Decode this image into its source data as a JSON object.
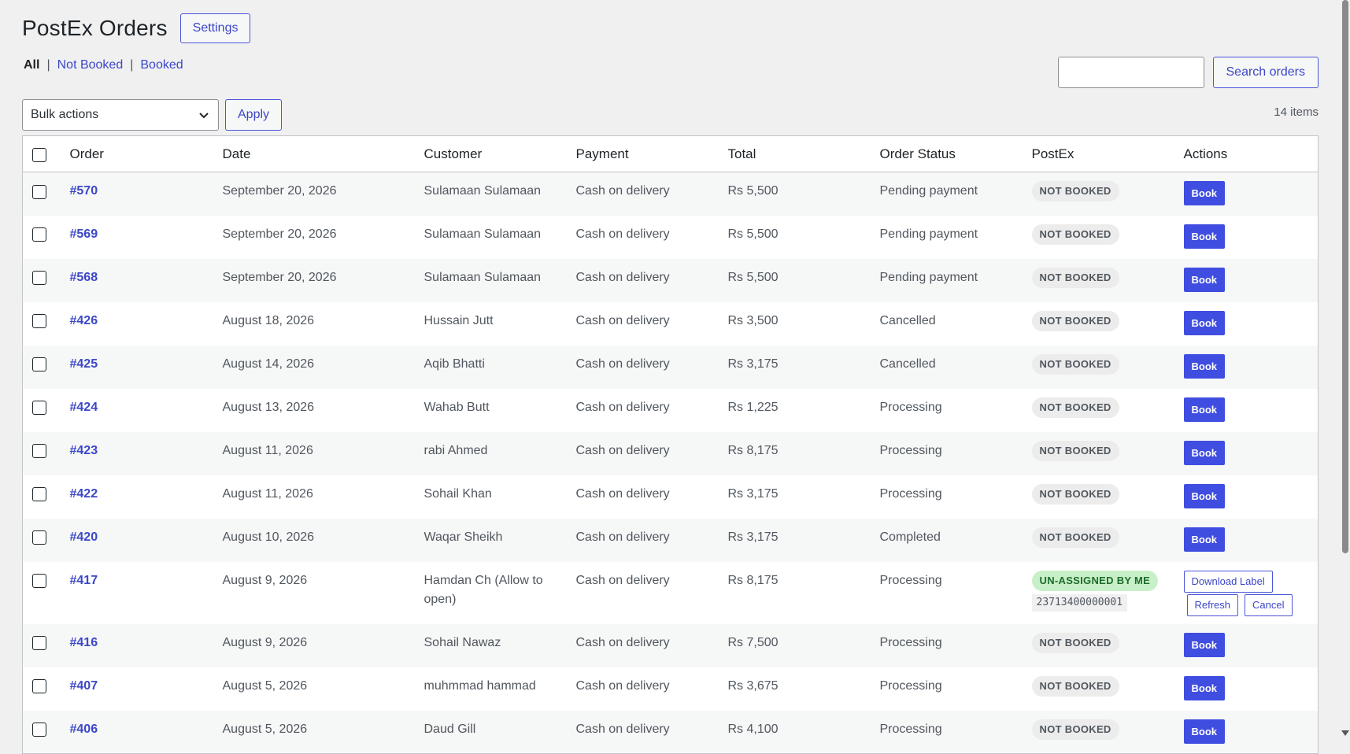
{
  "header": {
    "title": "PostEx Orders",
    "settings_label": "Settings"
  },
  "filters": [
    {
      "label": "All",
      "current": true
    },
    {
      "label": "Not Booked",
      "current": false
    },
    {
      "label": "Booked",
      "current": false
    }
  ],
  "search": {
    "value": "",
    "button_label": "Search orders"
  },
  "bulk": {
    "selected": "Bulk actions",
    "apply_label": "Apply",
    "items_count": "14 items"
  },
  "columns": [
    "Order",
    "Date",
    "Customer",
    "Payment",
    "Total",
    "Order Status",
    "PostEx",
    "Actions"
  ],
  "rows": [
    {
      "order": "#570",
      "date": "September 20, 2026",
      "customer": "Sulamaan Sulamaan",
      "payment": "Cash on delivery",
      "total": "Rs 5,500",
      "status": "Pending payment",
      "postex": "NOT BOOKED",
      "action": "Book"
    },
    {
      "order": "#569",
      "date": "September 20, 2026",
      "customer": "Sulamaan Sulamaan",
      "payment": "Cash on delivery",
      "total": "Rs 5,500",
      "status": "Pending payment",
      "postex": "NOT BOOKED",
      "action": "Book"
    },
    {
      "order": "#568",
      "date": "September 20, 2026",
      "customer": "Sulamaan Sulamaan",
      "payment": "Cash on delivery",
      "total": "Rs 5,500",
      "status": "Pending payment",
      "postex": "NOT BOOKED",
      "action": "Book"
    },
    {
      "order": "#426",
      "date": "August 18, 2026",
      "customer": "Hussain Jutt",
      "payment": "Cash on delivery",
      "total": "Rs 3,500",
      "status": "Cancelled",
      "postex": "NOT BOOKED",
      "action": "Book"
    },
    {
      "order": "#425",
      "date": "August 14, 2026",
      "customer": "Aqib Bhatti",
      "payment": "Cash on delivery",
      "total": "Rs 3,175",
      "status": "Cancelled",
      "postex": "NOT BOOKED",
      "action": "Book"
    },
    {
      "order": "#424",
      "date": "August 13, 2026",
      "customer": "Wahab Butt",
      "payment": "Cash on delivery",
      "total": "Rs 1,225",
      "status": "Processing",
      "postex": "NOT BOOKED",
      "action": "Book"
    },
    {
      "order": "#423",
      "date": "August 11, 2026",
      "customer": "rabi Ahmed",
      "payment": "Cash on delivery",
      "total": "Rs 8,175",
      "status": "Processing",
      "postex": "NOT BOOKED",
      "action": "Book"
    },
    {
      "order": "#422",
      "date": "August 11, 2026",
      "customer": "Sohail Khan",
      "payment": "Cash on delivery",
      "total": "Rs 3,175",
      "status": "Processing",
      "postex": "NOT BOOKED",
      "action": "Book"
    },
    {
      "order": "#420",
      "date": "August 10, 2026",
      "customer": "Waqar Sheikh",
      "payment": "Cash on delivery",
      "total": "Rs 3,175",
      "status": "Completed",
      "postex": "NOT BOOKED",
      "action": "Book"
    },
    {
      "order": "#417",
      "date": "August 9, 2026",
      "customer": "Hamdan Ch (Allow to open)",
      "payment": "Cash on delivery",
      "total": "Rs 8,175",
      "status": "Processing",
      "postex": "UN-ASSIGNED BY ME",
      "tracking": "23713400000001",
      "booked": true,
      "actions": [
        "Download Label",
        "Refresh",
        "Cancel"
      ]
    },
    {
      "order": "#416",
      "date": "August 9, 2026",
      "customer": "Sohail Nawaz",
      "payment": "Cash on delivery",
      "total": "Rs 7,500",
      "status": "Processing",
      "postex": "NOT BOOKED",
      "action": "Book"
    },
    {
      "order": "#407",
      "date": "August 5, 2026",
      "customer": "muhmmad hammad",
      "payment": "Cash on delivery",
      "total": "Rs 3,675",
      "status": "Processing",
      "postex": "NOT BOOKED",
      "action": "Book"
    },
    {
      "order": "#406",
      "date": "August 5, 2026",
      "customer": "Daud Gill",
      "payment": "Cash on delivery",
      "total": "Rs 4,100",
      "status": "Processing",
      "postex": "NOT BOOKED",
      "action": "Book"
    }
  ],
  "colors": {
    "accent": "#3f4de0",
    "link": "#3c47c7",
    "badge_green_bg": "#c8f0c8",
    "badge_green_text": "#1e6b2e",
    "badge_grey_bg": "#ececec"
  },
  "icons": {
    "select_chevron": "chevron-down-icon"
  }
}
